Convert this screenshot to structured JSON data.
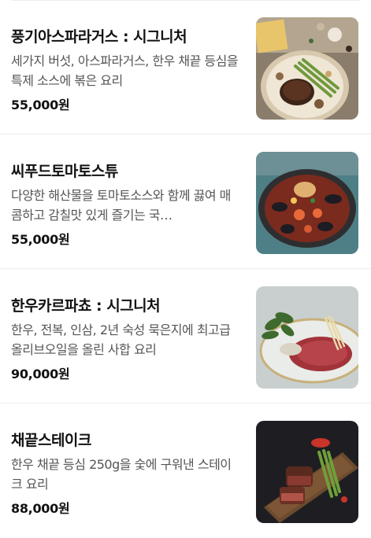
{
  "menu": {
    "items": [
      {
        "name": "풍기아스파라거스 : 시그니처",
        "description": "세가지 버섯, 아스파라거스, 한우 채끝 등심을 특제 소스에 볶은 요리",
        "price": "55,000원",
        "photo_icon": "mushroom-asparagus-plate"
      },
      {
        "name": "씨푸드토마토스튜",
        "description": "다양한 해산물을 토마토소스와 함께 끓여 매콤하고 감칠맛 있게 즐기는 국…",
        "price": "55,000원",
        "photo_icon": "seafood-stew-pot"
      },
      {
        "name": "한우카르파쵸 : 시그니처",
        "description": "한우, 전복, 인삼, 2년 숙성 묵은지에 최고급 올리브오일을 올린 사합 요리",
        "price": "90,000원",
        "photo_icon": "carpaccio-plate"
      },
      {
        "name": "채끝스테이크",
        "description": "한우 채끝 등심 250g을 숯에 구워낸 스테이크 요리",
        "price": "88,000원",
        "photo_icon": "steak-board"
      }
    ]
  }
}
